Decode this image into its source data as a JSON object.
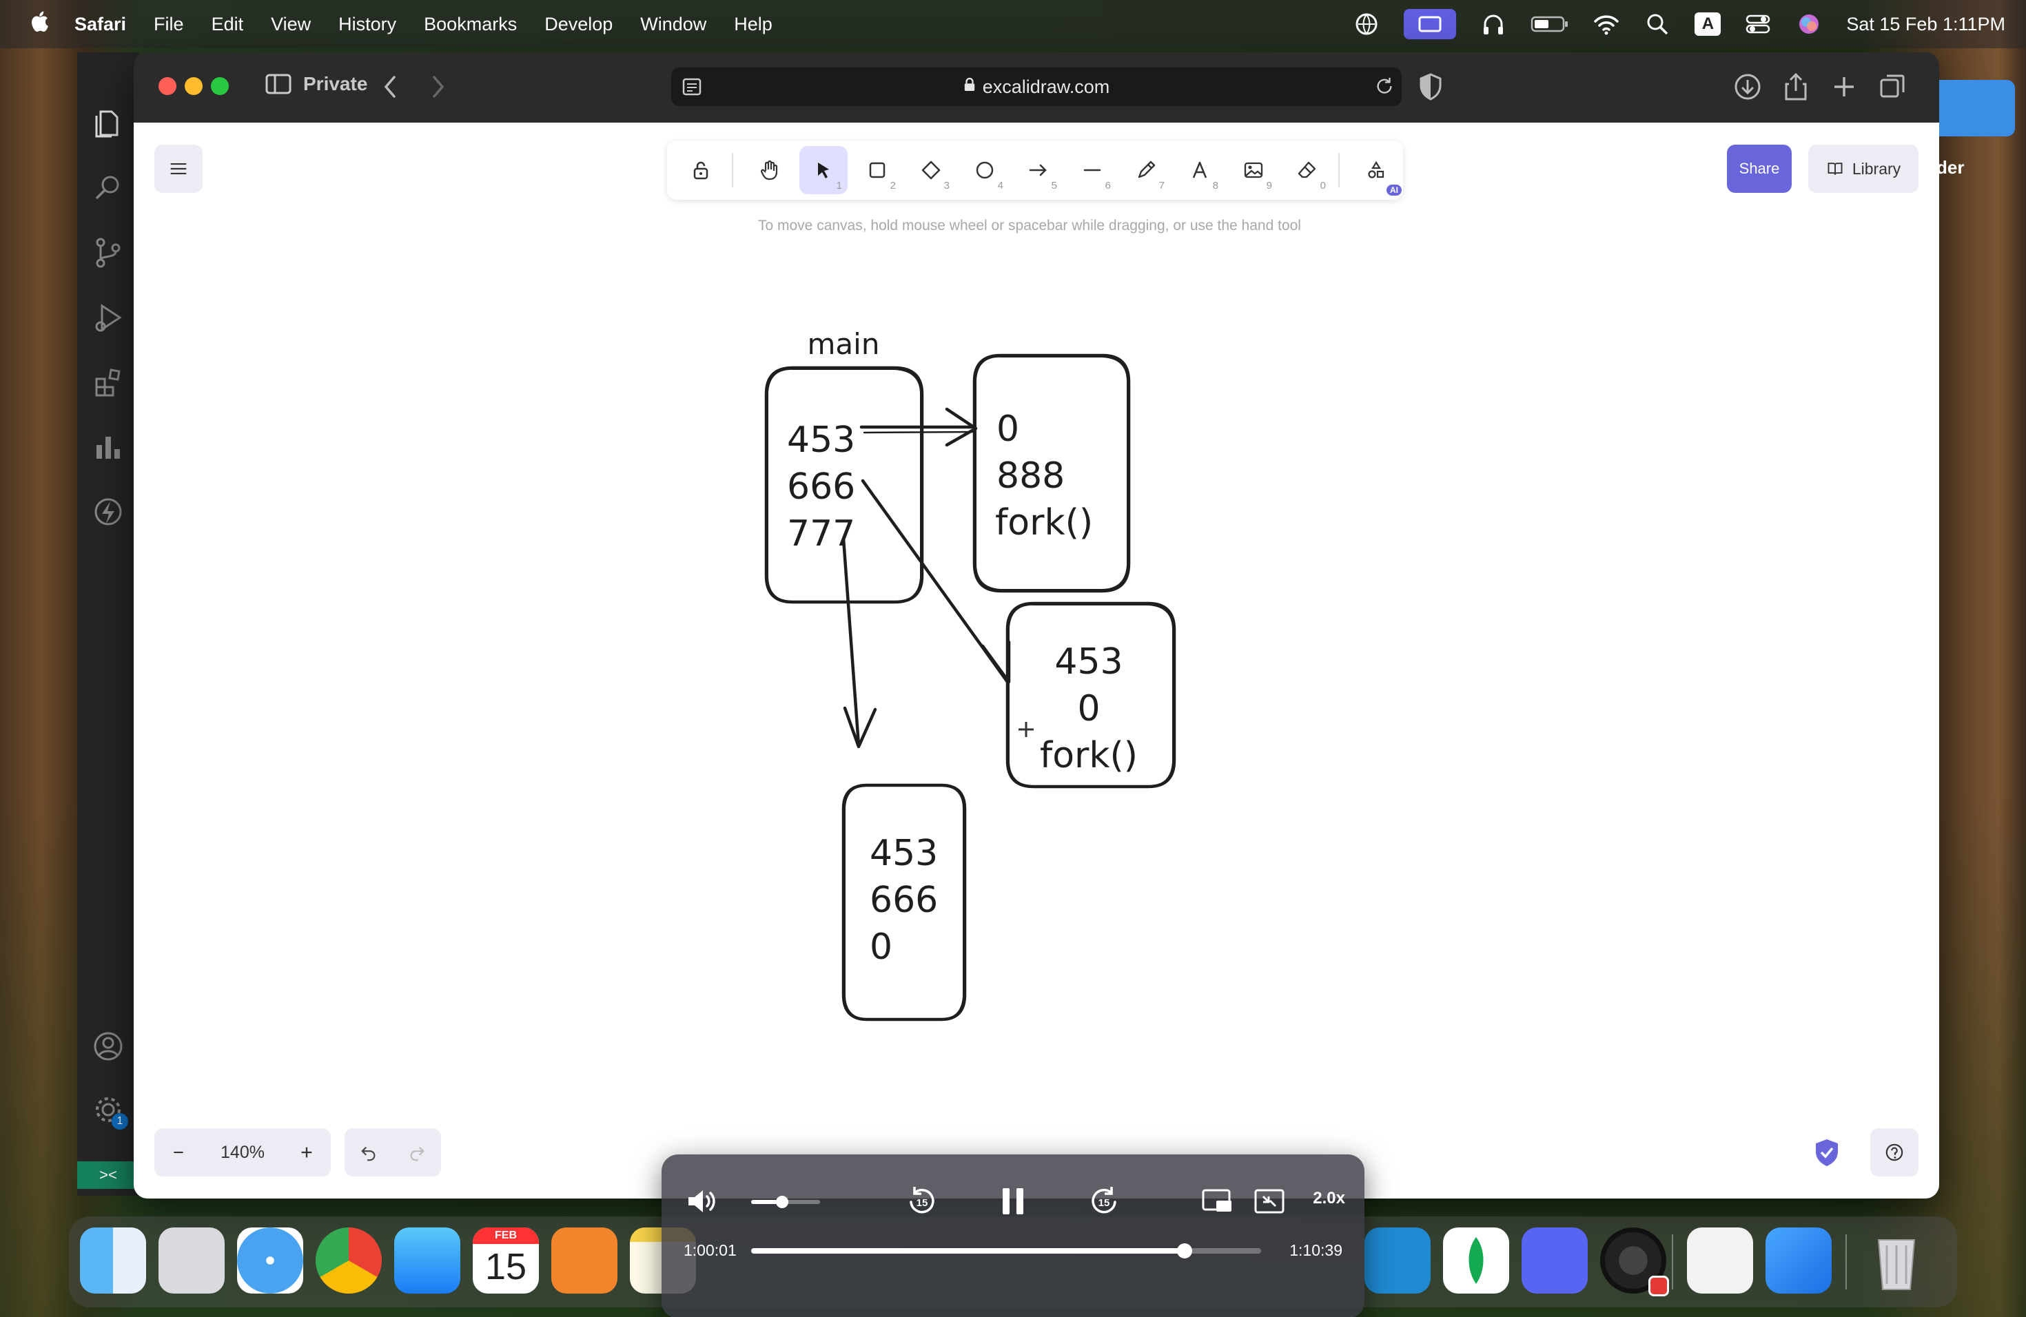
{
  "menubar": {
    "app_name": "Safari",
    "items": [
      "File",
      "Edit",
      "View",
      "History",
      "Bookmarks",
      "Develop",
      "Window",
      "Help"
    ],
    "clock": "Sat 15 Feb  1:11PM",
    "input_indicator": "A"
  },
  "browser": {
    "tab_mode_label": "Private",
    "url": "excalidraw.com",
    "peek_text": "der"
  },
  "excalidraw": {
    "tools": [
      {
        "name": "lock",
        "key": ""
      },
      {
        "name": "hand",
        "key": ""
      },
      {
        "name": "selection",
        "key": "1",
        "active": true
      },
      {
        "name": "rectangle",
        "key": "2"
      },
      {
        "name": "diamond",
        "key": "3"
      },
      {
        "name": "ellipse",
        "key": "4"
      },
      {
        "name": "arrow",
        "key": "5"
      },
      {
        "name": "line",
        "key": "6"
      },
      {
        "name": "draw",
        "key": "7"
      },
      {
        "name": "text",
        "key": "8"
      },
      {
        "name": "image",
        "key": "9"
      },
      {
        "name": "eraser",
        "key": "0"
      },
      {
        "name": "more-tools",
        "key": ""
      }
    ],
    "ai_badge": "AI",
    "hint": "To move canvas, hold mouse wheel or spacebar while dragging, or use the hand tool",
    "share_label": "Share",
    "library_label": "Library",
    "zoom_level": "140%",
    "drawing": {
      "main_label": "main",
      "main_box": [
        "453",
        "666",
        "777"
      ],
      "top_right_box": [
        "0",
        "888",
        "fork()"
      ],
      "middle_right_box": [
        "453",
        "0",
        "fork()"
      ],
      "bottom_box": [
        "453",
        "666",
        "0"
      ]
    }
  },
  "sidebar": {
    "settings_badge": "1"
  },
  "player": {
    "elapsed": "1:00:01",
    "remaining": "1:10:39",
    "speed": "2.0x",
    "progress": 0.85,
    "volume": 0.45,
    "skip_back": "15",
    "skip_forward": "15"
  },
  "dock": {
    "calendar_month": "FEB",
    "calendar_day": "15",
    "apps": [
      "finder",
      "launchpad",
      "safari",
      "chrome",
      "mail",
      "calendar",
      "books",
      "notes",
      "vscode",
      "mongodb-compass",
      "discord",
      "obs",
      "system-information",
      "pages",
      "trash"
    ]
  },
  "colors": {
    "accent": "#6965db",
    "toolbar_active": "#e0dfff",
    "canvas": "#ffffff"
  }
}
